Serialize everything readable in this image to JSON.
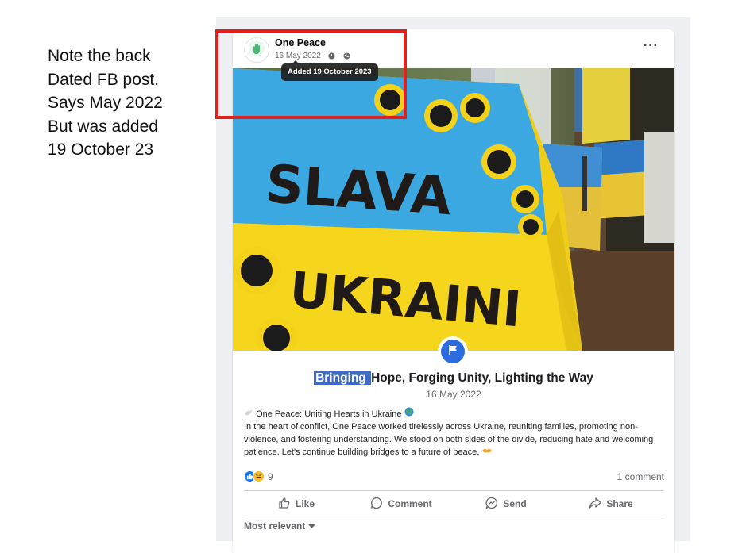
{
  "note": {
    "lines": [
      "Note the back",
      "Dated FB post.",
      "Says May 2022",
      "But was added",
      "19 October 23"
    ]
  },
  "post": {
    "author": "One Peace",
    "date": "16 May 2022",
    "separator": "·",
    "tooltip": "Added 19 October 2023",
    "more_label": "···",
    "image": {
      "sign_line1": "SLAVA",
      "sign_line2": "UKRAINI"
    },
    "event": {
      "title_highlight": "Bringing ",
      "title_rest": "Hope, Forging Unity, Lighting the Way",
      "date": "16 May 2022"
    },
    "text": {
      "line1": " One Peace: Uniting Hearts in Ukraine ",
      "body": "In the heart of conflict, One Peace worked tirelessly across Ukraine, reuniting families, promoting non-violence, and fostering understanding. We stood on both sides of the divide, reducing hate and welcoming patience. Let's continue building bridges to a future of peace. "
    },
    "reactions": {
      "count": "9",
      "comments": "1 comment"
    },
    "actions": {
      "like": "Like",
      "comment": "Comment",
      "send": "Send",
      "share": "Share"
    },
    "sort_label": "Most relevant"
  },
  "icons": {
    "avatar": "hand-icon",
    "clock": "clock-icon",
    "globe": "globe-icon",
    "flag": "flag-icon",
    "like_reaction": "thumbs-up-icon",
    "haha_reaction": "laughing-face-icon",
    "dove": "dove-icon",
    "earth": "globe-emoji-icon",
    "hands": "handshake-icon"
  },
  "colors": {
    "annotation_box": "#e0201b",
    "accent": "#2d6cdf",
    "highlight": "#3f6ac6",
    "flag_blue": "#3aa5df",
    "flag_yellow": "#f2cf1c"
  }
}
